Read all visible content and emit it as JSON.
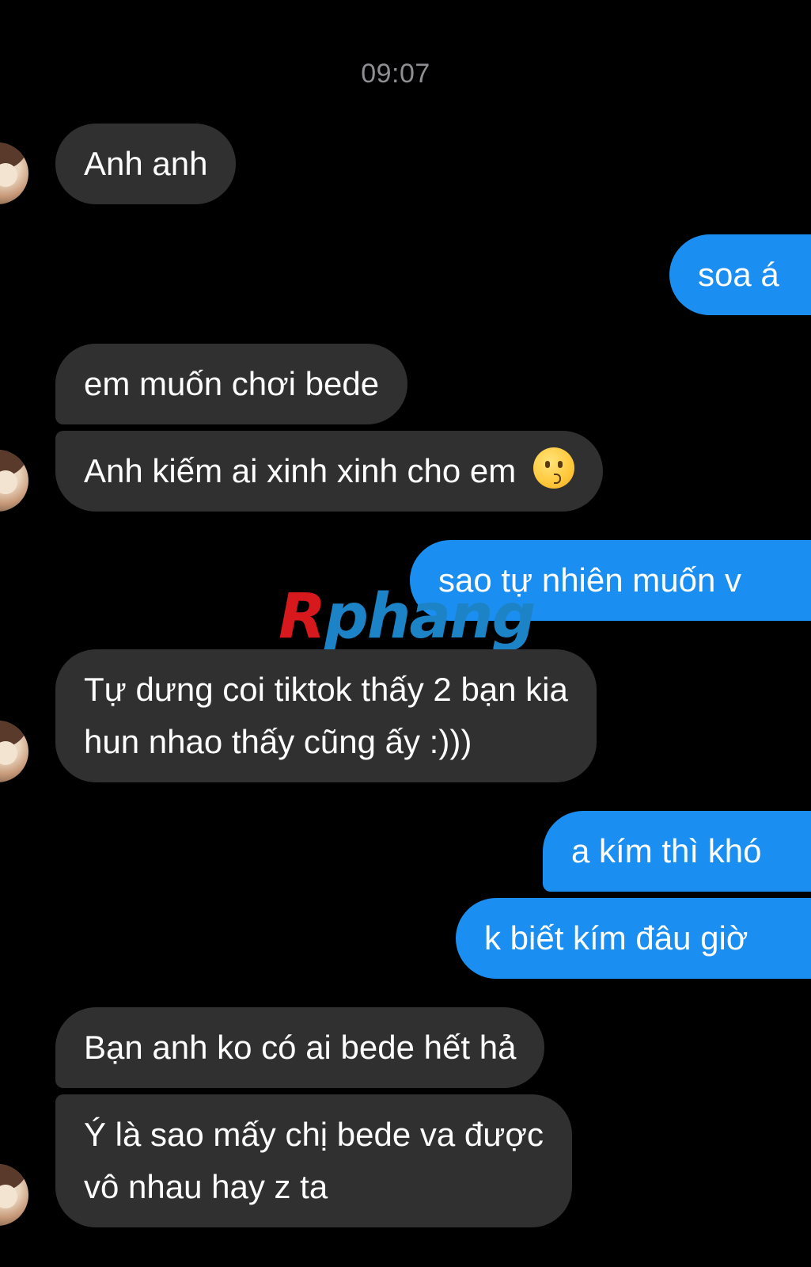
{
  "timestamp": "09:07",
  "watermark": {
    "first": "R",
    "rest": "phang"
  },
  "messages": [
    {
      "side": "in",
      "text": "Anh anh"
    },
    {
      "side": "out",
      "text": "soa á"
    },
    {
      "side": "in",
      "text": "em muốn chơi bede"
    },
    {
      "side": "in",
      "text": "Anh kiếm ai xinh xinh cho em",
      "emoji": "kissing-face-emoji"
    },
    {
      "side": "out",
      "text": "sao tự nhiên muốn v"
    },
    {
      "side": "in",
      "line1": "Tự dưng coi tiktok thấy 2 bạn kia",
      "line2": "hun nhao thấy cũng ấy :)))"
    },
    {
      "side": "out",
      "text": "a kím thì khó"
    },
    {
      "side": "out",
      "text": "k biết kím đâu giờ"
    },
    {
      "side": "in",
      "text": "Bạn anh ko có ai bede hết hả"
    },
    {
      "side": "in",
      "line1": "Ý là sao mấy chị bede va được",
      "line2": "vô nhau hay z ta"
    }
  ],
  "colors": {
    "background": "#000000",
    "incoming_bubble": "#303030",
    "outgoing_bubble": "#1b8ef2",
    "timestamp": "#8e8e93"
  }
}
